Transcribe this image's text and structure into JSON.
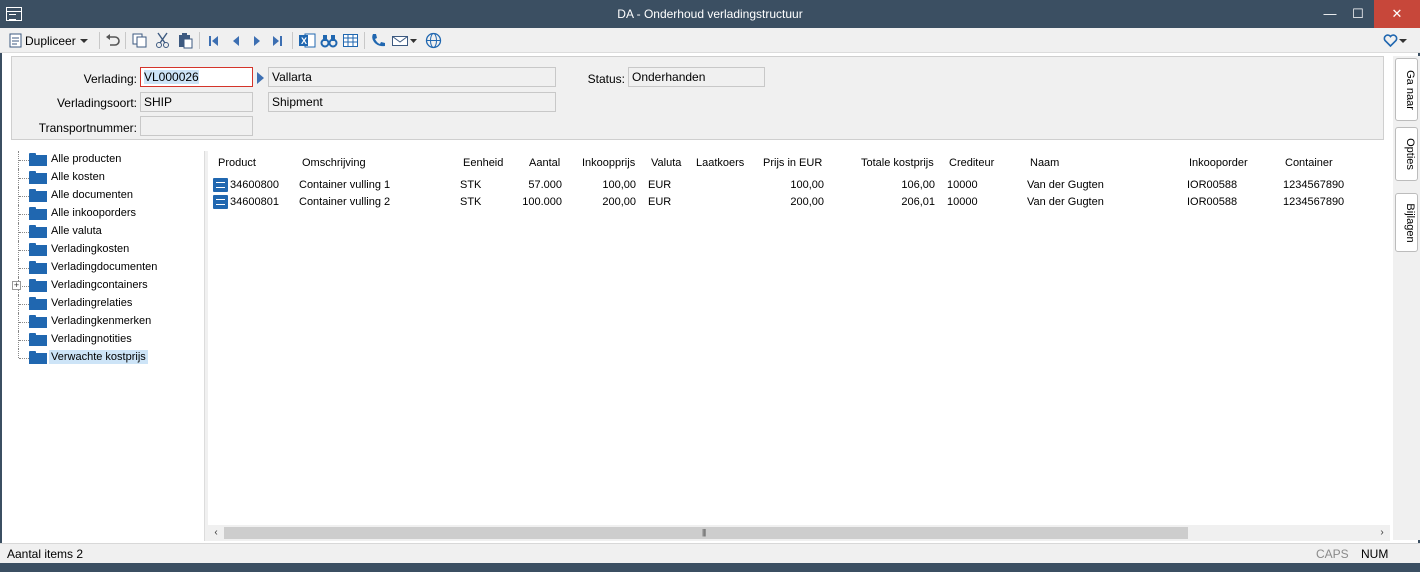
{
  "window": {
    "title": "DA - Onderhoud verladingstructuur",
    "min_glyph": "—",
    "max_glyph": "☐",
    "close_glyph": "✕"
  },
  "toolbar": {
    "duplicate_label": "Dupliceer",
    "icons": [
      "document-icon",
      "undo-icon",
      "copy-icon",
      "cut-icon",
      "paste-icon",
      "first-record-icon",
      "previous-record-icon",
      "next-record-icon",
      "last-record-icon",
      "excel-icon",
      "binoculars-icon",
      "table-icon",
      "phone-icon",
      "mail-icon",
      "globe-icon",
      "favorite-heart-icon"
    ]
  },
  "header": {
    "verlading_label": "Verlading:",
    "verlading_value": "VL000026",
    "verlading_desc": "Vallarta",
    "verladingssoort_label": "Verladingsoort:",
    "verladingssoort_value": "SHIP",
    "verladingssoort_desc": "Shipment",
    "transportnummer_label": "Transportnummer:",
    "transportnummer_value": "",
    "status_label": "Status:",
    "status_value": "Onderhanden"
  },
  "sidetabs": [
    "Ga naar",
    "Opties",
    "Bijlagen"
  ],
  "tree": {
    "items": [
      {
        "label": "Alle producten"
      },
      {
        "label": "Alle kosten"
      },
      {
        "label": "Alle documenten"
      },
      {
        "label": "Alle inkooporders"
      },
      {
        "label": "Alle valuta"
      },
      {
        "label": "Verladingkosten"
      },
      {
        "label": "Verladingdocumenten"
      },
      {
        "label": "Verladingcontainers"
      },
      {
        "label": "Verladingrelaties"
      },
      {
        "label": "Verladingkenmerken"
      },
      {
        "label": "Verladingnotities"
      },
      {
        "label": "Verwachte kostprijs"
      }
    ],
    "expand_glyph": "+"
  },
  "grid": {
    "columns": [
      "Product",
      "Omschrijving",
      "Eenheid",
      "Aantal",
      "Inkoopprijs",
      "Valuta",
      "Laatkoers",
      "Prijs in EUR",
      "Totale kostprijs",
      "Crediteur",
      "Naam",
      "Inkooporder",
      "Container"
    ],
    "rows": [
      [
        "34600800",
        "Container vulling 1",
        "STK",
        "57.000",
        "100,00",
        "EUR",
        "",
        "100,00",
        "106,00",
        "10000",
        "Van der Gugten",
        "IOR00588",
        "1234567890"
      ],
      [
        "34600801",
        "Container vulling 2",
        "STK",
        "100.000",
        "200,00",
        "EUR",
        "",
        "200,00",
        "206,01",
        "10000",
        "Van der Gugten",
        "IOR00588",
        "1234567890"
      ]
    ],
    "scroll_left": "‹",
    "scroll_right": "›",
    "scroll_grip": "|||"
  },
  "status": {
    "items_count": "Aantal items 2",
    "caps": "CAPS",
    "num": "NUM"
  },
  "colors": {
    "titlebar": "#3b4f62",
    "accent_blue": "#2067b0",
    "close_red": "#c7473a",
    "active_border": "#d4342a"
  }
}
